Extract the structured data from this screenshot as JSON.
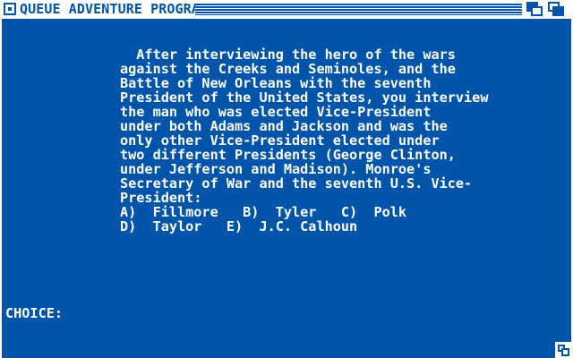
{
  "window": {
    "title": "QUEUE ADVENTURE PROGRAM"
  },
  "question": {
    "lines": [
      "  After interviewing the hero of the wars",
      "against the Creeks and Seminoles, and the",
      "Battle of New Orleans with the seventh",
      "President of the United States, you interview",
      "the man who was elected Vice-President",
      "under both Adams and Jackson and was the",
      "only other Vice-President elected under",
      "two different Presidents (George Clinton,",
      "under Jefferson and Madison). Monroe's",
      "Secretary of War and the seventh U.S. Vice-",
      "President:",
      "A)  Fillmore   B)  Tyler   C)  Polk",
      "D)  Taylor   E)  J.C. Calhoun"
    ]
  },
  "prompt": {
    "label": "CHOICE:",
    "value": ""
  },
  "colors": {
    "background": "#0055aa",
    "foreground": "#ffffff"
  },
  "icons": {
    "close": "close-gadget-icon",
    "depth_back": "depth-back-icon",
    "depth_front": "depth-front-icon",
    "resize": "resize-gadget-icon"
  }
}
